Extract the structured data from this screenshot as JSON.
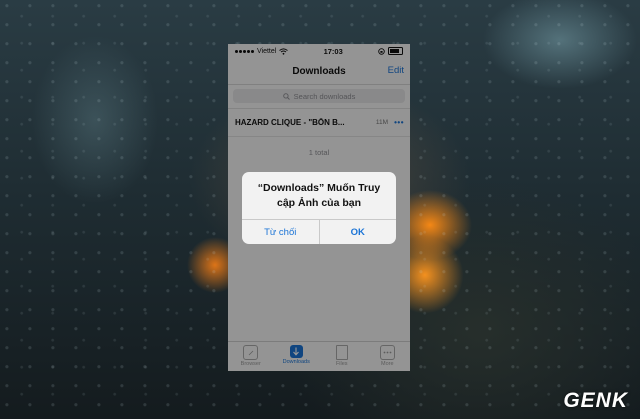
{
  "status_bar": {
    "carrier": "Viettel",
    "time": "17:03"
  },
  "nav": {
    "title": "Downloads",
    "edit_label": "Edit"
  },
  "search": {
    "placeholder": "Search downloads"
  },
  "downloads": [
    {
      "title": "HAZARD CLIQUE - \"BỐN B...",
      "size": "11M",
      "more": "•••"
    }
  ],
  "total_label": "1 total",
  "tabs": [
    {
      "label": "Browser",
      "icon": "compass-icon",
      "active": false
    },
    {
      "label": "Downloads",
      "icon": "download-arrow-icon",
      "active": true
    },
    {
      "label": "Files",
      "icon": "file-icon",
      "active": false
    },
    {
      "label": "More",
      "icon": "more-dots-icon",
      "active": false
    }
  ],
  "alert": {
    "message": "“Downloads” Muốn Truy cập Ảnh của bạn",
    "cancel_label": "Từ chối",
    "ok_label": "OK"
  },
  "watermark": "GENK",
  "colors": {
    "accent": "#1b74d6",
    "background_glow": "#ff8c14"
  }
}
